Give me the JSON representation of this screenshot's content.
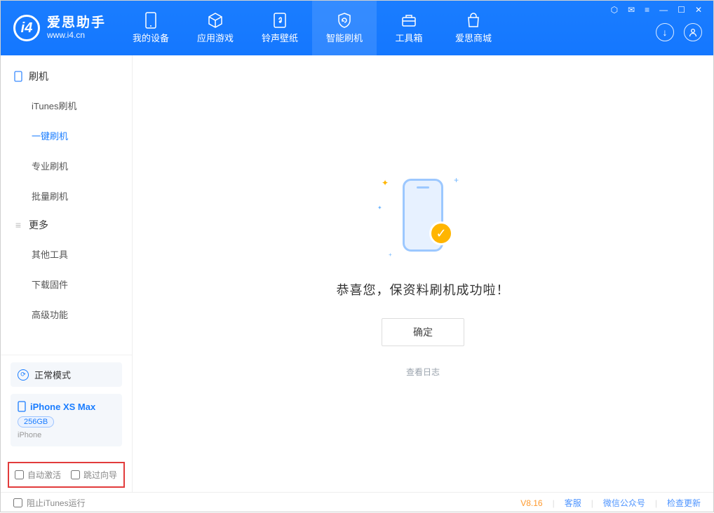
{
  "app": {
    "name_cn": "爱思助手",
    "name_en": "www.i4.cn"
  },
  "nav": {
    "items": [
      {
        "label": "我的设备"
      },
      {
        "label": "应用游戏"
      },
      {
        "label": "铃声壁纸"
      },
      {
        "label": "智能刷机"
      },
      {
        "label": "工具箱"
      },
      {
        "label": "爱思商城"
      }
    ]
  },
  "sidebar": {
    "group1": {
      "title": "刷机",
      "items": [
        "iTunes刷机",
        "一键刷机",
        "专业刷机",
        "批量刷机"
      ]
    },
    "group2": {
      "title": "更多",
      "items": [
        "其他工具",
        "下载固件",
        "高级功能"
      ]
    },
    "mode": "正常模式",
    "device": {
      "name": "iPhone XS Max",
      "capacity": "256GB",
      "type": "iPhone"
    },
    "options": {
      "auto_activate": "自动激活",
      "skip_guide": "跳过向导"
    }
  },
  "main": {
    "success_msg": "恭喜您，保资料刷机成功啦！",
    "ok_label": "确定",
    "log_link": "查看日志"
  },
  "footer": {
    "block_itunes": "阻止iTunes运行",
    "version": "V8.16",
    "links": [
      "客服",
      "微信公众号",
      "检查更新"
    ]
  }
}
